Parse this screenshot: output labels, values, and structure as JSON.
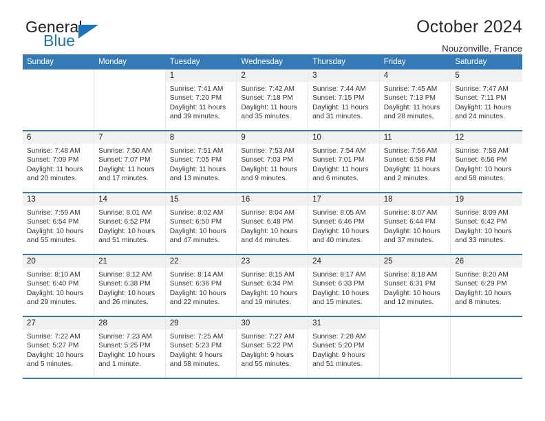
{
  "brand": {
    "name_top": "General",
    "name_bottom": "Blue",
    "accent_color": "#1b75bb",
    "triangle_icon": "brand-triangle-icon"
  },
  "header": {
    "title": "October 2024",
    "subtitle": "Nouzonville, France"
  },
  "theme": {
    "header_row_bg": "#337ab7",
    "header_row_text": "#ffffff",
    "day_number_bg": "#f1f1f1",
    "week_separator": "#337ab7",
    "body_text": "#333333"
  },
  "calendar": {
    "weekday_headers": [
      "Sunday",
      "Monday",
      "Tuesday",
      "Wednesday",
      "Thursday",
      "Friday",
      "Saturday"
    ],
    "weeks": [
      [
        {
          "empty": true
        },
        {
          "empty": true
        },
        {
          "day": "1",
          "sunrise": "Sunrise: 7:41 AM",
          "sunset": "Sunset: 7:20 PM",
          "daylight": "Daylight: 11 hours and 39 minutes."
        },
        {
          "day": "2",
          "sunrise": "Sunrise: 7:42 AM",
          "sunset": "Sunset: 7:18 PM",
          "daylight": "Daylight: 11 hours and 35 minutes."
        },
        {
          "day": "3",
          "sunrise": "Sunrise: 7:44 AM",
          "sunset": "Sunset: 7:15 PM",
          "daylight": "Daylight: 11 hours and 31 minutes."
        },
        {
          "day": "4",
          "sunrise": "Sunrise: 7:45 AM",
          "sunset": "Sunset: 7:13 PM",
          "daylight": "Daylight: 11 hours and 28 minutes."
        },
        {
          "day": "5",
          "sunrise": "Sunrise: 7:47 AM",
          "sunset": "Sunset: 7:11 PM",
          "daylight": "Daylight: 11 hours and 24 minutes."
        }
      ],
      [
        {
          "day": "6",
          "sunrise": "Sunrise: 7:48 AM",
          "sunset": "Sunset: 7:09 PM",
          "daylight": "Daylight: 11 hours and 20 minutes."
        },
        {
          "day": "7",
          "sunrise": "Sunrise: 7:50 AM",
          "sunset": "Sunset: 7:07 PM",
          "daylight": "Daylight: 11 hours and 17 minutes."
        },
        {
          "day": "8",
          "sunrise": "Sunrise: 7:51 AM",
          "sunset": "Sunset: 7:05 PM",
          "daylight": "Daylight: 11 hours and 13 minutes."
        },
        {
          "day": "9",
          "sunrise": "Sunrise: 7:53 AM",
          "sunset": "Sunset: 7:03 PM",
          "daylight": "Daylight: 11 hours and 9 minutes."
        },
        {
          "day": "10",
          "sunrise": "Sunrise: 7:54 AM",
          "sunset": "Sunset: 7:01 PM",
          "daylight": "Daylight: 11 hours and 6 minutes."
        },
        {
          "day": "11",
          "sunrise": "Sunrise: 7:56 AM",
          "sunset": "Sunset: 6:58 PM",
          "daylight": "Daylight: 11 hours and 2 minutes."
        },
        {
          "day": "12",
          "sunrise": "Sunrise: 7:58 AM",
          "sunset": "Sunset: 6:56 PM",
          "daylight": "Daylight: 10 hours and 58 minutes."
        }
      ],
      [
        {
          "day": "13",
          "sunrise": "Sunrise: 7:59 AM",
          "sunset": "Sunset: 6:54 PM",
          "daylight": "Daylight: 10 hours and 55 minutes."
        },
        {
          "day": "14",
          "sunrise": "Sunrise: 8:01 AM",
          "sunset": "Sunset: 6:52 PM",
          "daylight": "Daylight: 10 hours and 51 minutes."
        },
        {
          "day": "15",
          "sunrise": "Sunrise: 8:02 AM",
          "sunset": "Sunset: 6:50 PM",
          "daylight": "Daylight: 10 hours and 47 minutes."
        },
        {
          "day": "16",
          "sunrise": "Sunrise: 8:04 AM",
          "sunset": "Sunset: 6:48 PM",
          "daylight": "Daylight: 10 hours and 44 minutes."
        },
        {
          "day": "17",
          "sunrise": "Sunrise: 8:05 AM",
          "sunset": "Sunset: 6:46 PM",
          "daylight": "Daylight: 10 hours and 40 minutes."
        },
        {
          "day": "18",
          "sunrise": "Sunrise: 8:07 AM",
          "sunset": "Sunset: 6:44 PM",
          "daylight": "Daylight: 10 hours and 37 minutes."
        },
        {
          "day": "19",
          "sunrise": "Sunrise: 8:09 AM",
          "sunset": "Sunset: 6:42 PM",
          "daylight": "Daylight: 10 hours and 33 minutes."
        }
      ],
      [
        {
          "day": "20",
          "sunrise": "Sunrise: 8:10 AM",
          "sunset": "Sunset: 6:40 PM",
          "daylight": "Daylight: 10 hours and 29 minutes."
        },
        {
          "day": "21",
          "sunrise": "Sunrise: 8:12 AM",
          "sunset": "Sunset: 6:38 PM",
          "daylight": "Daylight: 10 hours and 26 minutes."
        },
        {
          "day": "22",
          "sunrise": "Sunrise: 8:14 AM",
          "sunset": "Sunset: 6:36 PM",
          "daylight": "Daylight: 10 hours and 22 minutes."
        },
        {
          "day": "23",
          "sunrise": "Sunrise: 8:15 AM",
          "sunset": "Sunset: 6:34 PM",
          "daylight": "Daylight: 10 hours and 19 minutes."
        },
        {
          "day": "24",
          "sunrise": "Sunrise: 8:17 AM",
          "sunset": "Sunset: 6:33 PM",
          "daylight": "Daylight: 10 hours and 15 minutes."
        },
        {
          "day": "25",
          "sunrise": "Sunrise: 8:18 AM",
          "sunset": "Sunset: 6:31 PM",
          "daylight": "Daylight: 10 hours and 12 minutes."
        },
        {
          "day": "26",
          "sunrise": "Sunrise: 8:20 AM",
          "sunset": "Sunset: 6:29 PM",
          "daylight": "Daylight: 10 hours and 8 minutes."
        }
      ],
      [
        {
          "day": "27",
          "sunrise": "Sunrise: 7:22 AM",
          "sunset": "Sunset: 5:27 PM",
          "daylight": "Daylight: 10 hours and 5 minutes."
        },
        {
          "day": "28",
          "sunrise": "Sunrise: 7:23 AM",
          "sunset": "Sunset: 5:25 PM",
          "daylight": "Daylight: 10 hours and 1 minute."
        },
        {
          "day": "29",
          "sunrise": "Sunrise: 7:25 AM",
          "sunset": "Sunset: 5:23 PM",
          "daylight": "Daylight: 9 hours and 58 minutes."
        },
        {
          "day": "30",
          "sunrise": "Sunrise: 7:27 AM",
          "sunset": "Sunset: 5:22 PM",
          "daylight": "Daylight: 9 hours and 55 minutes."
        },
        {
          "day": "31",
          "sunrise": "Sunrise: 7:28 AM",
          "sunset": "Sunset: 5:20 PM",
          "daylight": "Daylight: 9 hours and 51 minutes."
        },
        {
          "empty": true
        },
        {
          "empty": true
        }
      ]
    ]
  }
}
